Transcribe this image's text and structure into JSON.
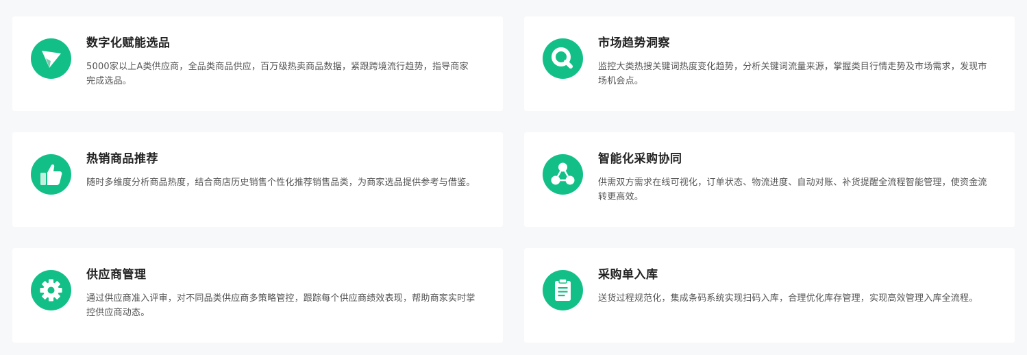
{
  "colors": {
    "background": "#f7f8fa",
    "card": "#ffffff",
    "accent": "#12c087",
    "title": "#222222",
    "text": "#555555"
  },
  "features": [
    {
      "icon": "paper-plane-icon",
      "title": "数字化赋能选品",
      "description": "5000家以上A类供应商，全品类商品供应，百万级热卖商品数据，紧跟跨境流行趋势，指导商家完成选品。"
    },
    {
      "icon": "magnifier-icon",
      "title": "市场趋势洞察",
      "description": "监控大类热搜关键词热度变化趋势，分析关键词流量来源，掌握类目行情走势及市场需求，发现市场机会点。"
    },
    {
      "icon": "thumbs-up-icon",
      "title": "热销商品推荐",
      "description": "随时多维度分析商品热度，结合商店历史销售个性化推荐销售品类，为商家选品提供参考与借鉴。"
    },
    {
      "icon": "network-nodes-icon",
      "title": "智能化采购协同",
      "description": "供需双方需求在线可视化，订单状态、物流进度、自动对账、补货提醒全流程智能管理，使资金流转更高效。"
    },
    {
      "icon": "gear-icon",
      "title": "供应商管理",
      "description": "通过供应商准入评审，对不同品类供应商多策略管控，跟踪每个供应商绩效表现，帮助商家实时掌控供应商动态。"
    },
    {
      "icon": "clipboard-icon",
      "title": "采购单入库",
      "description": "送货过程规范化，集成条码系统实现扫码入库，合理优化库存管理，实现高效管理入库全流程。"
    }
  ]
}
